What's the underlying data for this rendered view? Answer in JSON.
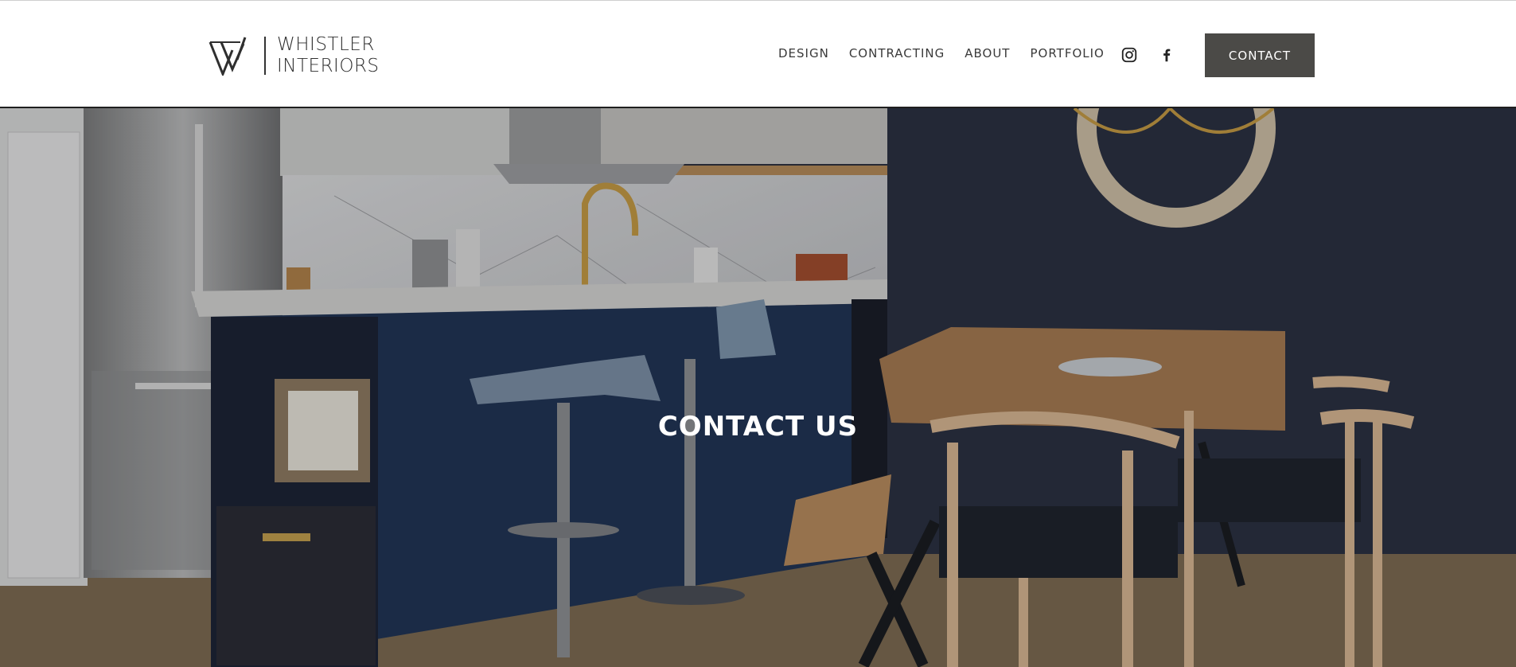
{
  "header": {
    "logo": {
      "line1": "WHISTLER",
      "line2": "INTERIORS",
      "icon": "whistler-logo-mark"
    },
    "nav": [
      {
        "label": "DESIGN"
      },
      {
        "label": "CONTRACTING"
      },
      {
        "label": "ABOUT"
      },
      {
        "label": "PORTFOLIO"
      }
    ],
    "social": [
      {
        "icon": "instagram-icon"
      },
      {
        "icon": "facebook-icon"
      }
    ],
    "cta_label": "CONTACT"
  },
  "hero": {
    "title": "CONTACT US",
    "image": "kitchen-dining-interior-photo"
  },
  "colors": {
    "button_bg": "#4b4a47",
    "header_bg": "#ffffff",
    "text_dark": "#3a3a3a",
    "hero_text": "#ffffff"
  }
}
